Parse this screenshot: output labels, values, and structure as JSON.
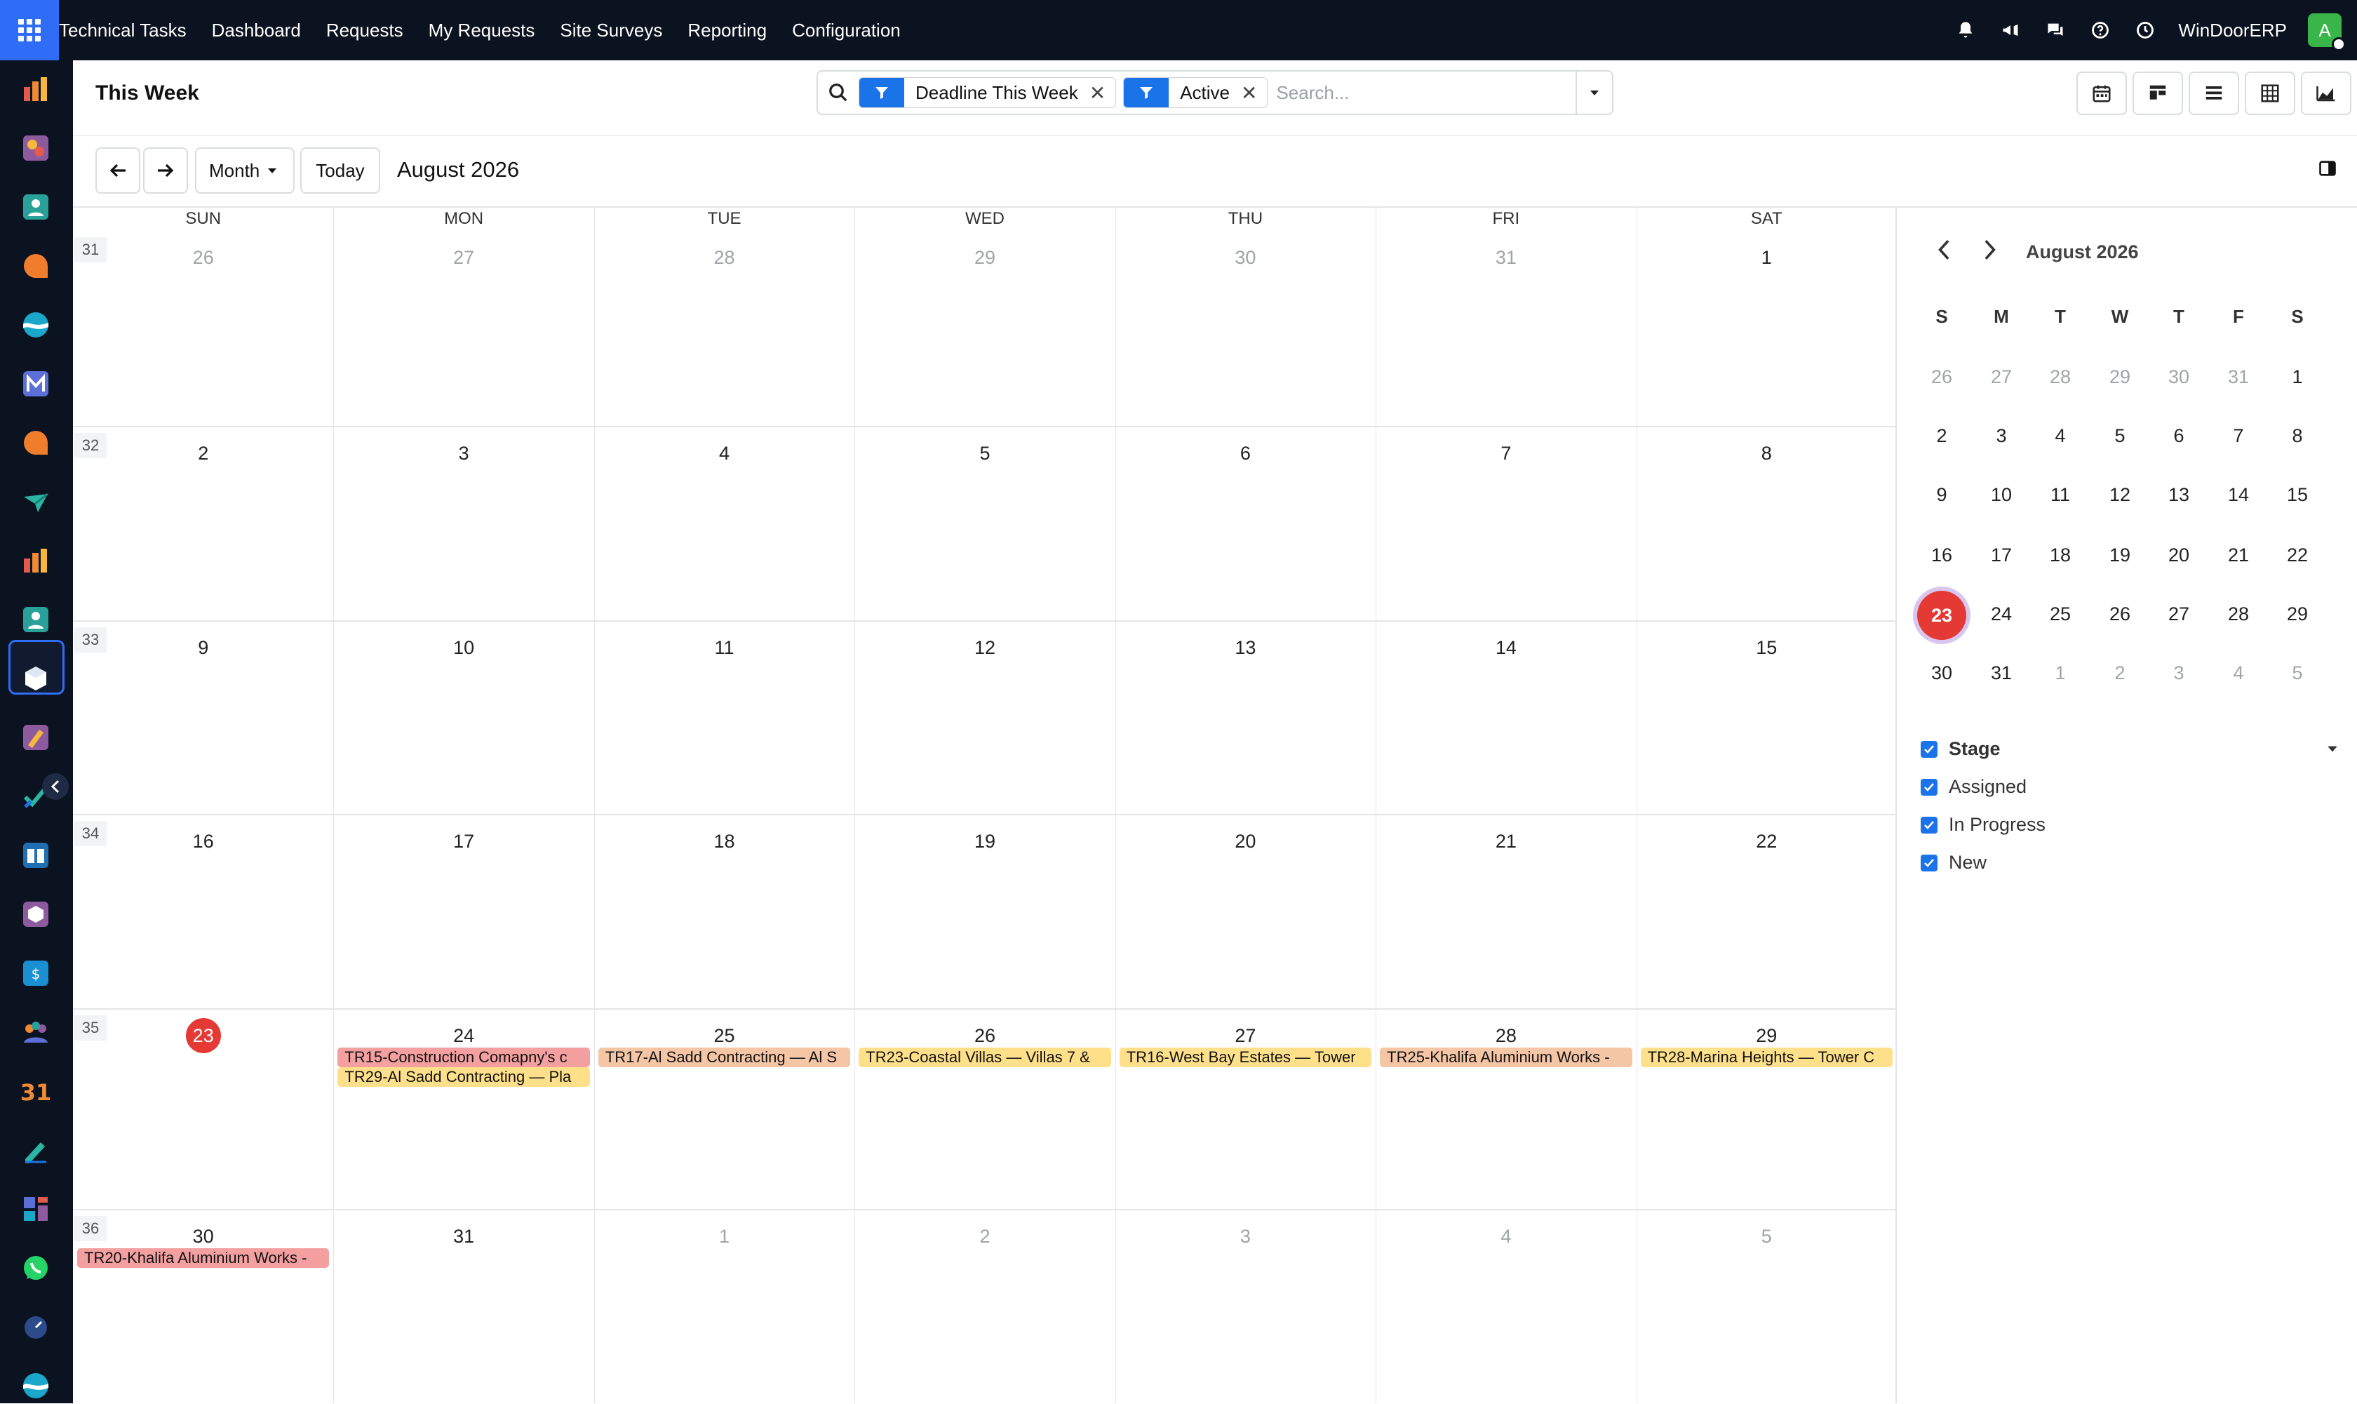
{
  "topnav": {
    "app_name": "Technical Tasks",
    "menus": [
      "Dashboard",
      "Requests",
      "My Requests",
      "Site Surveys",
      "Reporting",
      "Configuration"
    ],
    "company": "WinDoorERP",
    "avatar_letter": "A",
    "icons": [
      "bell-icon",
      "megaphone-icon",
      "chat-icon",
      "help-icon",
      "clock-icon"
    ]
  },
  "sidebar": {
    "icons": [
      "reporting-app-icon",
      "art-app-icon",
      "contacts-app-icon",
      "discuss-app-icon",
      "wave-app-icon",
      "mail-app-icon",
      "livechat-app-icon",
      "plane-app-icon",
      "charts-app-icon",
      "employees-app-icon",
      "technical-tasks-app-icon",
      "brush-app-icon",
      "todo-app-icon",
      "knowledge-app-icon",
      "inventory-app-icon",
      "sales-app-icon",
      "team-app-icon",
      "calendar-app-icon",
      "sign-app-icon",
      "dashboards-app-icon",
      "whatsapp-app-icon",
      "timer-app-icon",
      "wave2-app-icon"
    ],
    "calendar_icon_text": "31"
  },
  "control": {
    "title": "This Week",
    "facets": [
      "Deadline This Week",
      "Active"
    ],
    "search_placeholder": "Search..."
  },
  "toolbar": {
    "scale": "Month",
    "today": "Today",
    "range": "August 2026"
  },
  "calendar": {
    "weekdays": [
      "SUN",
      "MON",
      "TUE",
      "WED",
      "THU",
      "FRI",
      "SAT"
    ],
    "weeks": [
      {
        "num": "31",
        "days": [
          "26",
          "27",
          "28",
          "29",
          "30",
          "31",
          "1"
        ]
      },
      {
        "num": "32",
        "days": [
          "2",
          "3",
          "4",
          "5",
          "6",
          "7",
          "8"
        ]
      },
      {
        "num": "33",
        "days": [
          "9",
          "10",
          "11",
          "12",
          "13",
          "14",
          "15"
        ]
      },
      {
        "num": "34",
        "days": [
          "16",
          "17",
          "18",
          "19",
          "20",
          "21",
          "22"
        ]
      },
      {
        "num": "35",
        "days": [
          "23",
          "24",
          "25",
          "26",
          "27",
          "28",
          "29"
        ]
      },
      {
        "num": "36",
        "days": [
          "30",
          "31",
          "1",
          "2",
          "3",
          "4",
          "5"
        ]
      }
    ],
    "today": "23",
    "events": [
      {
        "text": "TR15-Construction Comapny's c",
        "color": "#f4a0a0"
      },
      {
        "text": "TR29-Al Sadd Contracting — Pla",
        "color": "#ffe08a"
      },
      {
        "text": "TR17-Al Sadd Contracting — Al S",
        "color": "#f5c6a5"
      },
      {
        "text": "TR23-Coastal Villas — Villas 7 &",
        "color": "#ffe08a"
      },
      {
        "text": "TR16-West Bay Estates — Tower",
        "color": "#ffe08a"
      },
      {
        "text": "TR25-Khalifa Aluminium Works -",
        "color": "#f5c6a5"
      },
      {
        "text": "TR28-Marina Heights — Tower C",
        "color": "#ffe08a"
      },
      {
        "text": "TR20-Khalifa Aluminium Works -",
        "color": "#f4a0a0"
      }
    ]
  },
  "minical": {
    "title": "August 2026",
    "headers": [
      "S",
      "M",
      "T",
      "W",
      "T",
      "F",
      "S"
    ],
    "weeks": [
      [
        "26",
        "27",
        "28",
        "29",
        "30",
        "31",
        "1"
      ],
      [
        "2",
        "3",
        "4",
        "5",
        "6",
        "7",
        "8"
      ],
      [
        "9",
        "10",
        "11",
        "12",
        "13",
        "14",
        "15"
      ],
      [
        "16",
        "17",
        "18",
        "19",
        "20",
        "21",
        "22"
      ],
      [
        "23",
        "24",
        "25",
        "26",
        "27",
        "28",
        "29"
      ],
      [
        "30",
        "31",
        "1",
        "2",
        "3",
        "4",
        "5"
      ]
    ],
    "today": "23"
  },
  "filters": {
    "group": "Stage",
    "options": [
      "Assigned",
      "In Progress",
      "New"
    ]
  },
  "colors": {
    "accent": "#1a73e8",
    "today": "#e53935",
    "topbar": "#0b1220"
  }
}
